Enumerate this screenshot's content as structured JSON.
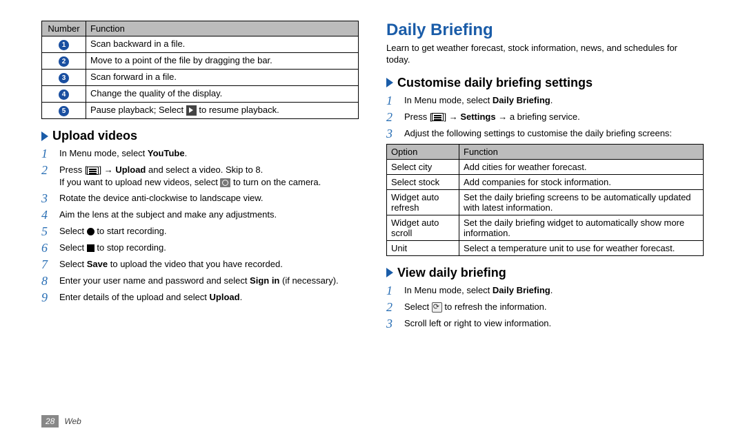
{
  "left": {
    "table_headers": {
      "number": "Number",
      "function": "Function"
    },
    "table_rows": [
      {
        "n": "1",
        "fn": "Scan backward in a file."
      },
      {
        "n": "2",
        "fn": "Move to a point of the file by dragging the bar."
      },
      {
        "n": "3",
        "fn": "Scan forward in a file."
      },
      {
        "n": "4",
        "fn": "Change the quality of the display."
      },
      {
        "n": "5",
        "fn_a": "Pause playback; Select ",
        "fn_b": " to resume playback."
      }
    ],
    "h2": "Upload videos",
    "steps": {
      "s1a": "In Menu mode, select ",
      "s1b": "YouTube",
      "s1c": ".",
      "s2a": "Press [",
      "s2b": "] → ",
      "s2c": "Upload",
      "s2d": " and select a video. Skip to 8.",
      "s2e": "If you want to upload new videos, select ",
      "s2f": " to turn on the camera.",
      "s3": "Rotate the device anti-clockwise to landscape view.",
      "s4": "Aim the lens at the subject and make any adjustments.",
      "s5a": "Select ",
      "s5b": " to start recording.",
      "s6a": "Select ",
      "s6b": " to stop recording.",
      "s7a": "Select ",
      "s7b": "Save",
      "s7c": " to upload the video that you have recorded.",
      "s8a": "Enter your user name and password and select ",
      "s8b": "Sign in",
      "s8c": " (if necessary).",
      "s9a": "Enter details of the upload and select ",
      "s9b": "Upload",
      "s9c": "."
    }
  },
  "right": {
    "h1": "Daily Briefing",
    "intro": "Learn to get weather forecast, stock information, news, and schedules for today.",
    "h2a": "Customise daily briefing settings",
    "stepsA": {
      "s1a": "In Menu mode, select ",
      "s1b": "Daily Briefing",
      "s1c": ".",
      "s2a": "Press [",
      "s2b": "] → ",
      "s2c": "Settings",
      "s2d": " → a briefing service.",
      "s3": "Adjust the following settings to customise the daily briefing screens:"
    },
    "opt_headers": {
      "option": "Option",
      "function": "Function"
    },
    "opt_rows": [
      {
        "o": "Select city",
        "f": "Add cities for weather forecast."
      },
      {
        "o": "Select stock",
        "f": "Add companies for stock information."
      },
      {
        "o": "Widget auto refresh",
        "f": "Set the daily briefing screens to be automatically updated with latest information."
      },
      {
        "o": "Widget auto scroll",
        "f": "Set the daily briefing widget to automatically show more information."
      },
      {
        "o": "Unit",
        "f": "Select a temperature unit to use for weather forecast."
      }
    ],
    "h2b": "View daily briefing",
    "stepsB": {
      "s1a": "In Menu mode, select ",
      "s1b": "Daily Briefing",
      "s1c": ".",
      "s2a": "Select ",
      "s2b": " to refresh the information.",
      "s3": "Scroll left or right to view information."
    }
  },
  "footer": {
    "page": "28",
    "section": "Web"
  }
}
